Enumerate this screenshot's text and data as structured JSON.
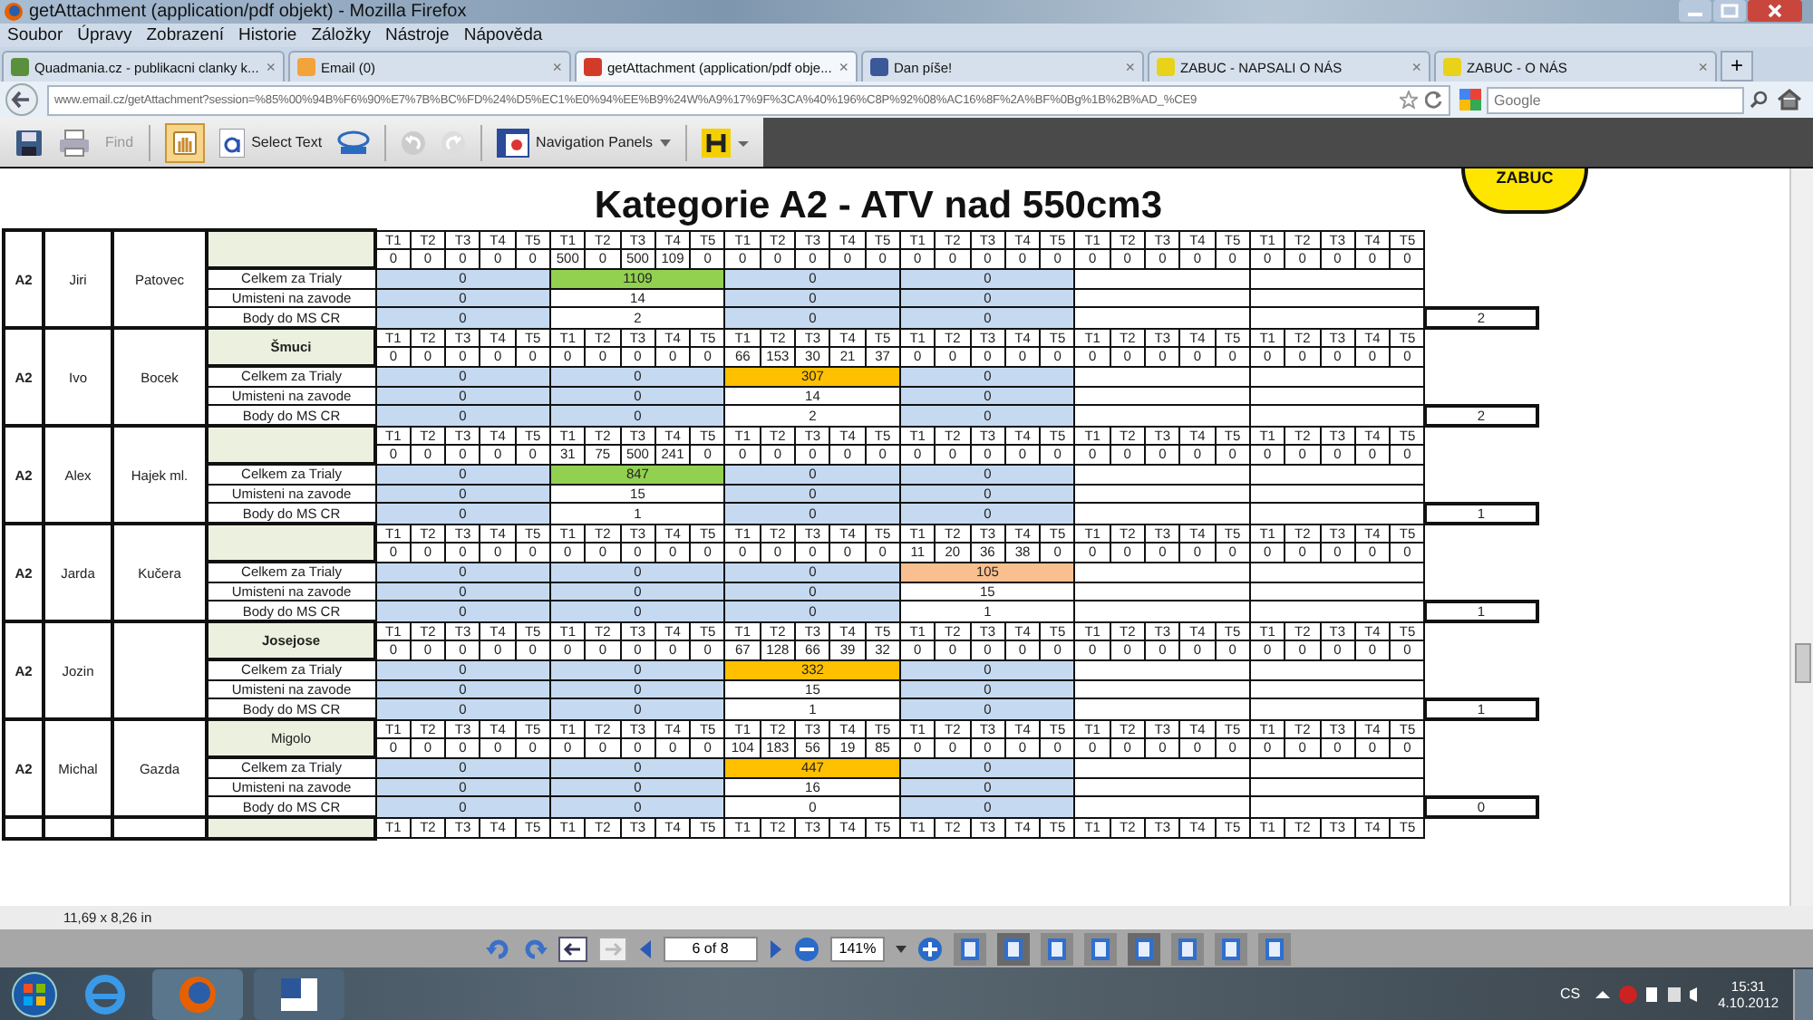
{
  "window": {
    "title": "getAttachment (application/pdf objekt) - Mozilla Firefox"
  },
  "menu": [
    {
      "label": "Soubor"
    },
    {
      "label": "Úpravy"
    },
    {
      "label": "Zobrazení"
    },
    {
      "label": "Historie"
    },
    {
      "label": "Záložky"
    },
    {
      "label": "Nástroje"
    },
    {
      "label": "Nápověda"
    }
  ],
  "tabs": [
    {
      "label": "Quadmania.cz - publikacni clanky k...",
      "selected": false,
      "close": "×"
    },
    {
      "label": "Email (0)",
      "selected": false,
      "close": "×"
    },
    {
      "label": "getAttachment (application/pdf obje...",
      "selected": true,
      "close": "×"
    },
    {
      "label": "Dan píše!",
      "selected": false,
      "close": "×"
    },
    {
      "label": "ZABUC - NAPSALI O NÁS",
      "selected": false,
      "close": "×"
    },
    {
      "label": "ZABUC - O NÁS",
      "selected": false,
      "close": "×"
    }
  ],
  "new_tab": "+",
  "address": {
    "value": "www.email.cz/getAttachment?session=%85%00%94B%F6%90%E7%7B%BC%FD%24%D5%EC1%E0%94%EE%B9%24W%A9%17%9F%3CA%40%196%C8P%92%08%AC16%8F%2A%BF%0Bg%1B%2B%AD_%CE9"
  },
  "search": {
    "placeholder": "Google"
  },
  "pdf_toolbar": {
    "find": "Find",
    "select_text": "Select Text",
    "navigation": "Navigation Panels",
    "hand_selected": true
  },
  "document": {
    "title": "Kategorie A2 - ATV nad 550cm3",
    "logo": "ZABUC",
    "riders": [
      {
        "category": "A2",
        "first": "Jiri",
        "last": "Patovec",
        "t_labels": [
          "T1",
          "T2",
          "T3",
          "T4",
          "T5",
          "T1",
          "T2",
          "T3",
          "T4",
          "T5",
          "T1",
          "T2",
          "T3",
          "T4",
          "T5",
          "T1",
          "T2",
          "T3",
          "T4",
          "T5",
          "T1",
          "T2",
          "T3",
          "T4",
          "T5",
          "T1",
          "T2",
          "T3",
          "T4",
          "T5"
        ],
        "scores": [
          "0",
          "0",
          "0",
          "0",
          "0",
          "500",
          "0",
          "500",
          "109",
          "0",
          "0",
          "0",
          "0",
          "0",
          "0",
          "0",
          "0",
          "0",
          "0",
          "0",
          "0",
          "0",
          "0",
          "0",
          "0",
          "0",
          "0",
          "0",
          "0",
          "0"
        ],
        "summaries": [
          {
            "label": "Celkem za Trialy",
            "cells": [
              {
                "value": "0",
                "color": "#c5d9f1"
              },
              {
                "value": "1109",
                "color": "#92d050"
              },
              {
                "value": "0",
                "color": "#c5d9f1"
              },
              {
                "value": "0",
                "color": "#c5d9f1"
              }
            ]
          },
          {
            "label": "Umisteni na zavode",
            "cells": [
              {
                "value": "0",
                "color": "#c5d9f1"
              },
              {
                "value": "14",
                "color": "#ffffff"
              },
              {
                "value": "0",
                "color": "#c5d9f1"
              },
              {
                "value": "0",
                "color": "#c5d9f1"
              }
            ]
          },
          {
            "label": "Body do MS CR",
            "cells": [
              {
                "value": "0",
                "color": "#c5d9f1"
              },
              {
                "value": "2",
                "color": "#ffffff"
              },
              {
                "value": "0",
                "color": "#c5d9f1"
              },
              {
                "value": "0",
                "color": "#c5d9f1"
              }
            ]
          }
        ],
        "final": "2"
      },
      {
        "category": "A2",
        "first": "Ivo",
        "last": "Bocek",
        "nick": "Šmuci",
        "nick_bold": true,
        "t_labels": [
          "T1",
          "T2",
          "T3",
          "T4",
          "T5",
          "T1",
          "T2",
          "T3",
          "T4",
          "T5",
          "T1",
          "T2",
          "T3",
          "T4",
          "T5",
          "T1",
          "T2",
          "T3",
          "T4",
          "T5",
          "T1",
          "T2",
          "T3",
          "T4",
          "T5",
          "T1",
          "T2",
          "T3",
          "T4",
          "T5"
        ],
        "scores": [
          "0",
          "0",
          "0",
          "0",
          "0",
          "0",
          "0",
          "0",
          "0",
          "0",
          "66",
          "153",
          "30",
          "21",
          "37",
          "0",
          "0",
          "0",
          "0",
          "0",
          "0",
          "0",
          "0",
          "0",
          "0",
          "0",
          "0",
          "0",
          "0",
          "0"
        ],
        "summaries": [
          {
            "label": "Celkem za Trialy",
            "cells": [
              {
                "value": "0",
                "color": "#c5d9f1"
              },
              {
                "value": "0",
                "color": "#c5d9f1"
              },
              {
                "value": "307",
                "color": "#ffc000"
              },
              {
                "value": "0",
                "color": "#c5d9f1"
              }
            ]
          },
          {
            "label": "Umisteni na zavode",
            "cells": [
              {
                "value": "0",
                "color": "#c5d9f1"
              },
              {
                "value": "0",
                "color": "#c5d9f1"
              },
              {
                "value": "14",
                "color": "#ffffff"
              },
              {
                "value": "0",
                "color": "#c5d9f1"
              }
            ]
          },
          {
            "label": "Body do MS CR",
            "cells": [
              {
                "value": "0",
                "color": "#c5d9f1"
              },
              {
                "value": "0",
                "color": "#c5d9f1"
              },
              {
                "value": "2",
                "color": "#ffffff"
              },
              {
                "value": "0",
                "color": "#c5d9f1"
              }
            ]
          }
        ],
        "final": "2"
      },
      {
        "category": "A2",
        "first": "Alex",
        "last": "Hajek ml.",
        "t_labels": [
          "T1",
          "T2",
          "T3",
          "T4",
          "T5",
          "T1",
          "T2",
          "T3",
          "T4",
          "T5",
          "T1",
          "T2",
          "T3",
          "T4",
          "T5",
          "T1",
          "T2",
          "T3",
          "T4",
          "T5",
          "T1",
          "T2",
          "T3",
          "T4",
          "T5",
          "T1",
          "T2",
          "T3",
          "T4",
          "T5"
        ],
        "scores": [
          "0",
          "0",
          "0",
          "0",
          "0",
          "31",
          "75",
          "500",
          "241",
          "0",
          "0",
          "0",
          "0",
          "0",
          "0",
          "0",
          "0",
          "0",
          "0",
          "0",
          "0",
          "0",
          "0",
          "0",
          "0",
          "0",
          "0",
          "0",
          "0",
          "0"
        ],
        "summaries": [
          {
            "label": "Celkem za Trialy",
            "cells": [
              {
                "value": "0",
                "color": "#c5d9f1"
              },
              {
                "value": "847",
                "color": "#92d050"
              },
              {
                "value": "0",
                "color": "#c5d9f1"
              },
              {
                "value": "0",
                "color": "#c5d9f1"
              }
            ]
          },
          {
            "label": "Umisteni na zavode",
            "cells": [
              {
                "value": "0",
                "color": "#c5d9f1"
              },
              {
                "value": "15",
                "color": "#ffffff"
              },
              {
                "value": "0",
                "color": "#c5d9f1"
              },
              {
                "value": "0",
                "color": "#c5d9f1"
              }
            ]
          },
          {
            "label": "Body do MS CR",
            "cells": [
              {
                "value": "0",
                "color": "#c5d9f1"
              },
              {
                "value": "1",
                "color": "#ffffff"
              },
              {
                "value": "0",
                "color": "#c5d9f1"
              },
              {
                "value": "0",
                "color": "#c5d9f1"
              }
            ]
          }
        ],
        "final": "1"
      },
      {
        "category": "A2",
        "first": "Jarda",
        "last": "Kučera",
        "t_labels": [
          "T1",
          "T2",
          "T3",
          "T4",
          "T5",
          "T1",
          "T2",
          "T3",
          "T4",
          "T5",
          "T1",
          "T2",
          "T3",
          "T4",
          "T5",
          "T1",
          "T2",
          "T3",
          "T4",
          "T5",
          "T1",
          "T2",
          "T3",
          "T4",
          "T5",
          "T1",
          "T2",
          "T3",
          "T4",
          "T5"
        ],
        "scores": [
          "0",
          "0",
          "0",
          "0",
          "0",
          "0",
          "0",
          "0",
          "0",
          "0",
          "0",
          "0",
          "0",
          "0",
          "0",
          "11",
          "20",
          "36",
          "38",
          "0",
          "0",
          "0",
          "0",
          "0",
          "0",
          "0",
          "0",
          "0",
          "0",
          "0"
        ],
        "summaries": [
          {
            "label": "Celkem za Trialy",
            "cells": [
              {
                "value": "0",
                "color": "#c5d9f1"
              },
              {
                "value": "0",
                "color": "#c5d9f1"
              },
              {
                "value": "0",
                "color": "#c5d9f1"
              },
              {
                "value": "105",
                "color": "#fabf8f"
              }
            ]
          },
          {
            "label": "Umisteni na zavode",
            "cells": [
              {
                "value": "0",
                "color": "#c5d9f1"
              },
              {
                "value": "0",
                "color": "#c5d9f1"
              },
              {
                "value": "0",
                "color": "#c5d9f1"
              },
              {
                "value": "15",
                "color": "#ffffff"
              }
            ]
          },
          {
            "label": "Body do MS CR",
            "cells": [
              {
                "value": "0",
                "color": "#c5d9f1"
              },
              {
                "value": "0",
                "color": "#c5d9f1"
              },
              {
                "value": "0",
                "color": "#c5d9f1"
              },
              {
                "value": "1",
                "color": "#ffffff"
              }
            ]
          }
        ],
        "final": "1"
      },
      {
        "category": "A2",
        "first": "Jozin",
        "nick": "Josejose",
        "nick_bold": true,
        "t_labels": [
          "T1",
          "T2",
          "T3",
          "T4",
          "T5",
          "T1",
          "T2",
          "T3",
          "T4",
          "T5",
          "T1",
          "T2",
          "T3",
          "T4",
          "T5",
          "T1",
          "T2",
          "T3",
          "T4",
          "T5",
          "T1",
          "T2",
          "T3",
          "T4",
          "T5",
          "T1",
          "T2",
          "T3",
          "T4",
          "T5"
        ],
        "scores": [
          "0",
          "0",
          "0",
          "0",
          "0",
          "0",
          "0",
          "0",
          "0",
          "0",
          "67",
          "128",
          "66",
          "39",
          "32",
          "0",
          "0",
          "0",
          "0",
          "0",
          "0",
          "0",
          "0",
          "0",
          "0",
          "0",
          "0",
          "0",
          "0",
          "0"
        ],
        "summaries": [
          {
            "label": "Celkem za Trialy",
            "cells": [
              {
                "value": "0",
                "color": "#c5d9f1"
              },
              {
                "value": "0",
                "color": "#c5d9f1"
              },
              {
                "value": "332",
                "color": "#ffc000"
              },
              {
                "value": "0",
                "color": "#c5d9f1"
              }
            ]
          },
          {
            "label": "Umisteni na zavode",
            "cells": [
              {
                "value": "0",
                "color": "#c5d9f1"
              },
              {
                "value": "0",
                "color": "#c5d9f1"
              },
              {
                "value": "15",
                "color": "#ffffff"
              },
              {
                "value": "0",
                "color": "#c5d9f1"
              }
            ]
          },
          {
            "label": "Body do MS CR",
            "cells": [
              {
                "value": "0",
                "color": "#c5d9f1"
              },
              {
                "value": "0",
                "color": "#c5d9f1"
              },
              {
                "value": "1",
                "color": "#ffffff"
              },
              {
                "value": "0",
                "color": "#c5d9f1"
              }
            ]
          }
        ],
        "final": "1"
      },
      {
        "category": "A2",
        "first": "Michal",
        "last": "Gazda",
        "nick": "Migolo",
        "nick_bold": false,
        "t_labels": [
          "T1",
          "T2",
          "T3",
          "T4",
          "T5",
          "T1",
          "T2",
          "T3",
          "T4",
          "T5",
          "T1",
          "T2",
          "T3",
          "T4",
          "T5",
          "T1",
          "T2",
          "T3",
          "T4",
          "T5",
          "T1",
          "T2",
          "T3",
          "T4",
          "T5",
          "T1",
          "T2",
          "T3",
          "T4",
          "T5"
        ],
        "scores": [
          "0",
          "0",
          "0",
          "0",
          "0",
          "0",
          "0",
          "0",
          "0",
          "0",
          "104",
          "183",
          "56",
          "19",
          "85",
          "0",
          "0",
          "0",
          "0",
          "0",
          "0",
          "0",
          "0",
          "0",
          "0",
          "0",
          "0",
          "0",
          "0",
          "0"
        ],
        "summaries": [
          {
            "label": "Celkem za Trialy",
            "cells": [
              {
                "value": "0",
                "color": "#c5d9f1"
              },
              {
                "value": "0",
                "color": "#c5d9f1"
              },
              {
                "value": "447",
                "color": "#ffc000"
              },
              {
                "value": "0",
                "color": "#c5d9f1"
              }
            ]
          },
          {
            "label": "Umisteni na zavode",
            "cells": [
              {
                "value": "0",
                "color": "#c5d9f1"
              },
              {
                "value": "0",
                "color": "#c5d9f1"
              },
              {
                "value": "16",
                "color": "#ffffff"
              },
              {
                "value": "0",
                "color": "#c5d9f1"
              }
            ]
          },
          {
            "label": "Body do MS CR",
            "cells": [
              {
                "value": "0",
                "color": "#c5d9f1"
              },
              {
                "value": "0",
                "color": "#c5d9f1"
              },
              {
                "value": "0",
                "color": "#ffffff"
              },
              {
                "value": "0",
                "color": "#c5d9f1"
              }
            ]
          }
        ],
        "final": "0"
      },
      {
        "t_labels": [
          "T1",
          "T2",
          "T3",
          "T4",
          "T5",
          "T1",
          "T2",
          "T3",
          "T4",
          "T5",
          "T1",
          "T2",
          "T3",
          "T4",
          "T5",
          "T1",
          "T2",
          "T3",
          "T4",
          "T5",
          "T1",
          "T2",
          "T3",
          "T4",
          "T5",
          "T1",
          "T2",
          "T3",
          "T4",
          "T5"
        ]
      }
    ]
  },
  "status": {
    "page_size": "11,69 x 8,26 in"
  },
  "pdf_nav": {
    "page": "6 of 8",
    "zoom": "141%"
  },
  "taskbar": {
    "language": "CS",
    "time": "15:31",
    "date": "4.10.2012"
  }
}
